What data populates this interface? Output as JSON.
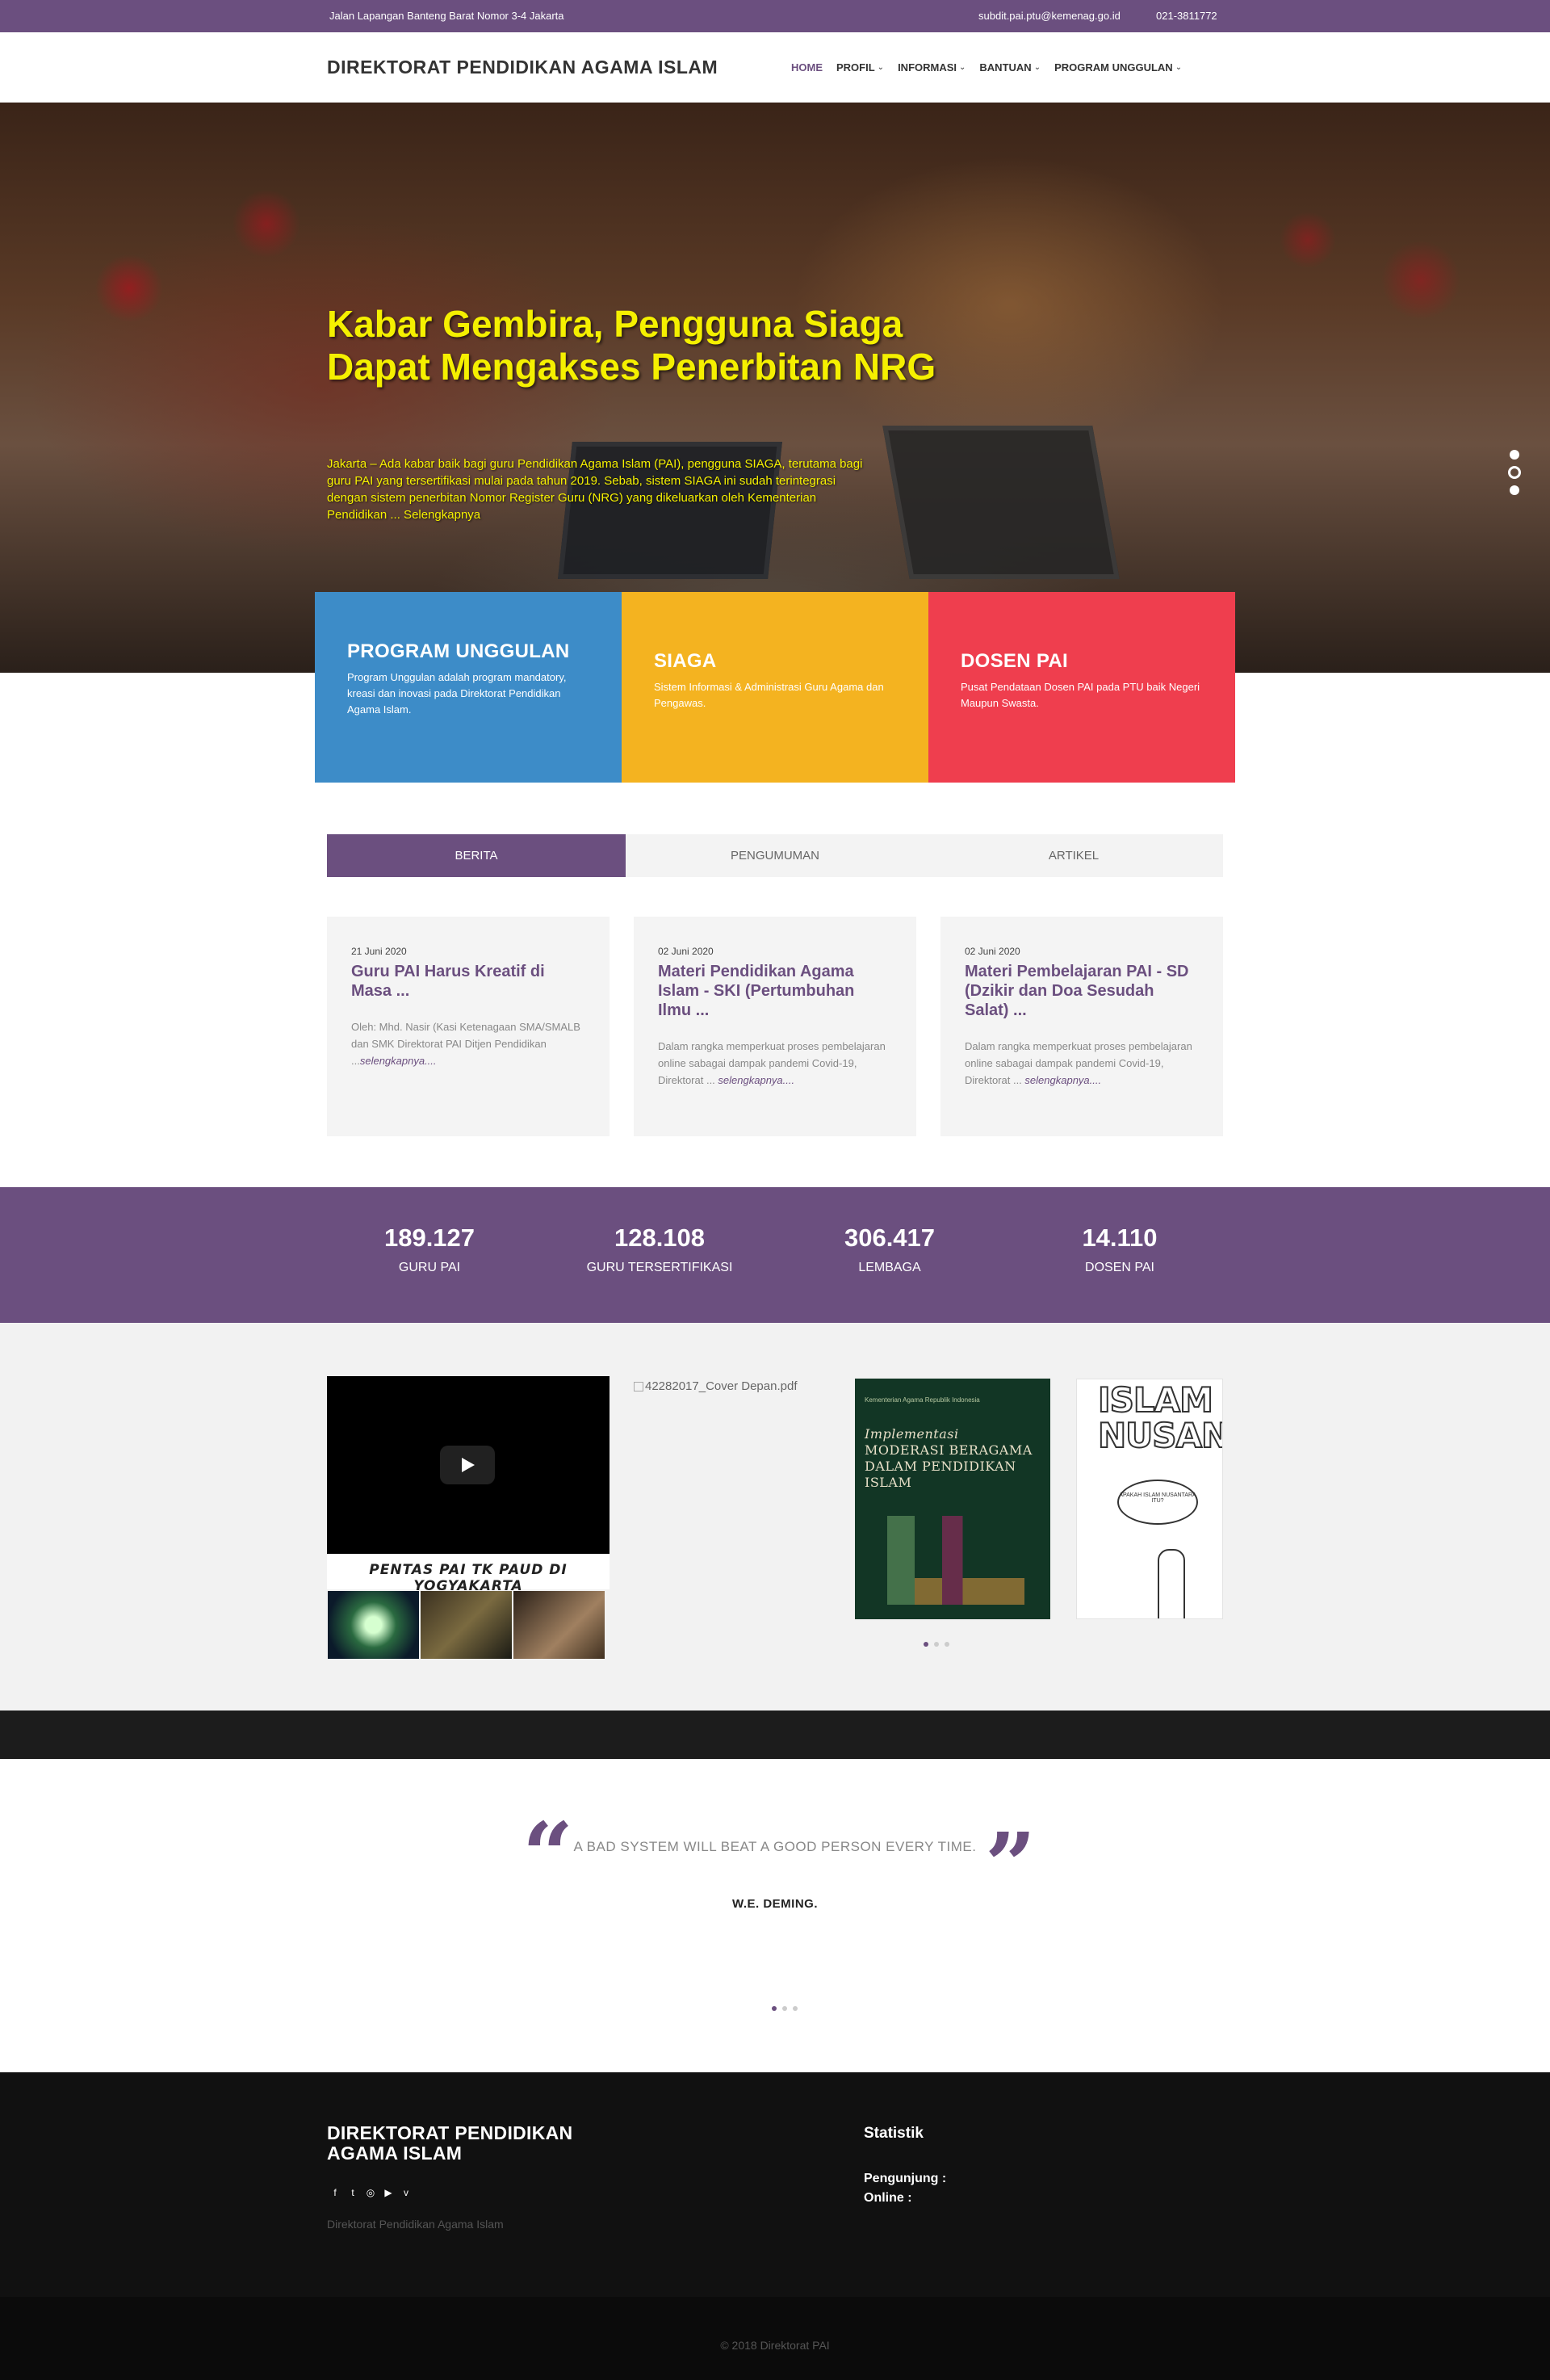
{
  "topbar": {
    "address": "Jalan Lapangan Banteng Barat Nomor 3-4 Jakarta",
    "email": "subdit.pai.ptu@kemenag.go.id",
    "phone": "021-3811772"
  },
  "header": {
    "brand": "DIREKTORAT PENDIDIKAN AGAMA ISLAM",
    "nav": [
      {
        "label": "HOME",
        "active": true
      },
      {
        "label": "PROFIL"
      },
      {
        "label": "INFORMASI"
      },
      {
        "label": "BANTUAN"
      },
      {
        "label": "PROGRAM UNGGULAN"
      }
    ]
  },
  "hero": {
    "title": "Kabar Gembira, Pengguna Siaga Dapat Mengakses Penerbitan NRG",
    "text": "Jakarta –  Ada kabar baik bagi guru Pendidikan Agama Islam (PAI), pengguna SIAGA, terutama bagi guru PAI yang tersertifikasi mulai pada tahun 2019. Sebab, sistem SIAGA ini sudah terintegrasi dengan sistem penerbitan Nomor Register Guru (NRG) yang dikeluarkan oleh Kementerian Pendidikan ... Selengkapnya",
    "slides": 3,
    "active_slide": 2
  },
  "features": [
    {
      "title": "PROGRAM UNGGULAN",
      "text": "Program Unggulan adalah program mandatory, kreasi dan inovasi pada Direktorat Pendidikan Agama Islam.",
      "color": "#3d8cc8"
    },
    {
      "title": "SIAGA",
      "text": "Sistem Informasi & Administrasi Guru Agama dan Pengawas.",
      "color": "#f4b320"
    },
    {
      "title": "DOSEN PAI",
      "text": "Pusat Pendataan Dosen PAI pada PTU baik Negeri Maupun Swasta.",
      "color": "#ef3e4e"
    }
  ],
  "tabs": [
    {
      "label": "BERITA",
      "active": true
    },
    {
      "label": "PENGUMUMAN"
    },
    {
      "label": "ARTIKEL"
    }
  ],
  "news": [
    {
      "date": "21 Juni 2020",
      "title": "Guru PAI Harus Kreatif di Masa ...",
      "excerpt": "Oleh: Mhd. Nasir (Kasi Ketenagaan SMA/SMALB dan SMK Direktorat PAI Ditjen Pendidikan ...",
      "more": "selengkapnya...."
    },
    {
      "date": "02 Juni 2020",
      "title": "Materi Pendidikan Agama Islam - SKI (Pertumbuhan Ilmu ...",
      "excerpt": "Dalam rangka memperkuat proses pembelajaran online sabagai dampak pandemi Covid-19, Direktorat ...",
      "more": "selengkapnya...."
    },
    {
      "date": "02 Juni 2020",
      "title": "Materi Pembelajaran PAI - SD (Dzikir dan Doa Sesudah Salat) ...",
      "excerpt": "Dalam rangka memperkuat proses pembelajaran online sabagai dampak pandemi Covid-19, Direktorat ...",
      "more": "selengkapnya...."
    }
  ],
  "stats": [
    {
      "value": "189.127",
      "label": "GURU PAI"
    },
    {
      "value": "128.108",
      "label": "GURU TERSERTIFIKASI"
    },
    {
      "value": "306.417",
      "label": "LEMBAGA"
    },
    {
      "value": "14.110",
      "label": "DOSEN PAI"
    }
  ],
  "media": {
    "video_caption": "PENTAS PAI TK PAUD DI YOGYAKARTA",
    "broken_image_alt": "42282017_Cover Depan.pdf",
    "book1_small": "Kementerian Agama Republik Indonesia",
    "book1_title_italic": "Implementasi",
    "book1_title": "MODERASI BERAGAMA DALAM PENDIDIKAN ISLAM",
    "book2_title": "ISLAM NUSANTARA",
    "book2_bubble": "APAKAH ISLAM NUSANTARA ITU?",
    "carousel_dots": 3
  },
  "quote": {
    "text": "A BAD SYSTEM WILL BEAT A GOOD PERSON EVERY TIME.",
    "author": "W.E. DEMING.",
    "dots": 3
  },
  "footer": {
    "brand": "DIREKTORAT PENDIDIKAN AGAMA ISLAM",
    "social": [
      "f",
      "t",
      "◎",
      "▶",
      "v"
    ],
    "description": "Direktorat Pendidikan Agama Islam",
    "statistik_title": "Statistik",
    "visitors_label": "Pengunjung :",
    "online_label": "Online :",
    "copyright": "© 2018 Direktorat PAI"
  },
  "colors": {
    "primary": "#6b4f7f",
    "hero_text": "#f5f000"
  }
}
